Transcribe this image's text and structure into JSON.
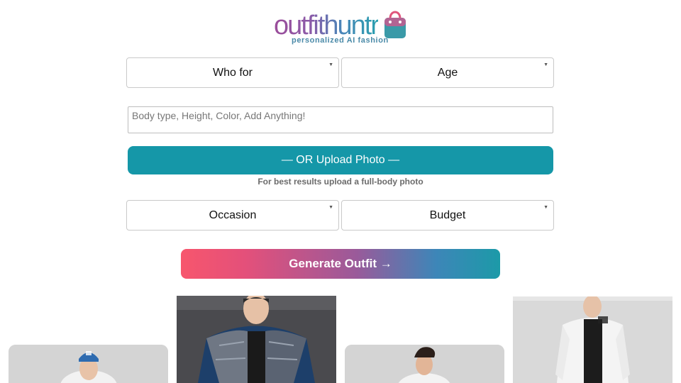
{
  "brand": {
    "logo_text": "outfithuntr",
    "tagline": "personalized AI fashion",
    "colors": {
      "primary": "#1597a8",
      "accent_start": "#f7566d",
      "accent_end": "#1c9aa8"
    }
  },
  "form": {
    "who_for": {
      "value": "Who for"
    },
    "age": {
      "value": "Age"
    },
    "details": {
      "placeholder": "Body type, Height, Color, Add Anything!"
    },
    "upload_label": "— OR Upload Photo —",
    "upload_hint": "For best results upload a full-body photo",
    "occasion": {
      "value": "Occasion"
    },
    "budget": {
      "value": "Budget"
    },
    "generate_label": "Generate Outfit →"
  },
  "gallery": {
    "items": [
      {
        "name": "outfit-photo-cap-man"
      },
      {
        "name": "outfit-photo-puffer-jacket"
      },
      {
        "name": "outfit-photo-denim-man"
      },
      {
        "name": "outfit-photo-white-bomber"
      }
    ]
  }
}
